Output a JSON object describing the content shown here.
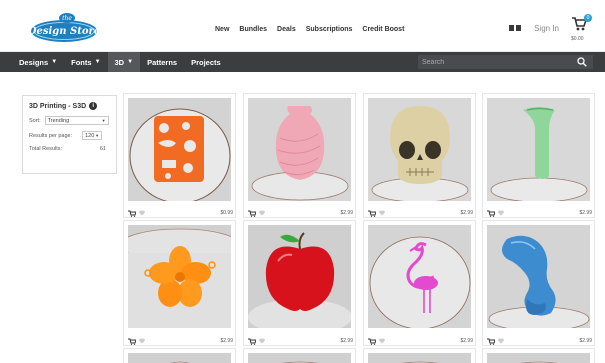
{
  "header": {
    "logo_text_small": "the",
    "logo_text": "Design Store",
    "top_links": [
      "New",
      "Bundles",
      "Deals",
      "Subscriptions",
      "Credit Boost"
    ],
    "sign_in": "Sign In",
    "cart_count": "0",
    "cart_total": "$0.00"
  },
  "nav": {
    "items": [
      "Designs",
      "Fonts",
      "3D",
      "Patterns",
      "Projects"
    ],
    "search_placeholder": "Search"
  },
  "filters": {
    "title": "3D Printing - S3D",
    "sort_label": "Sort:",
    "sort_value": "Trending",
    "per_page_label": "Results per page:",
    "per_page_value": "120",
    "total_label": "Total Results:",
    "total_value": "61"
  },
  "products": [
    {
      "name": "kids toy puzzle plate",
      "price": "$0.99"
    },
    {
      "name": "pink spiral vase",
      "price": "$2.99"
    },
    {
      "name": "skull model",
      "price": "$2.99"
    },
    {
      "name": "green vase",
      "price": "$2.99"
    },
    {
      "name": "flower pendant",
      "price": "$2.99"
    },
    {
      "name": "red apple",
      "price": "$2.99"
    },
    {
      "name": "flamingo",
      "price": "$2.99"
    },
    {
      "name": "dolphin",
      "price": "$2.99"
    }
  ],
  "colors": {
    "navbar": "#3c3d3f",
    "accent_blue": "#2a9fd6",
    "logo_blue": "#1e7fc0"
  }
}
